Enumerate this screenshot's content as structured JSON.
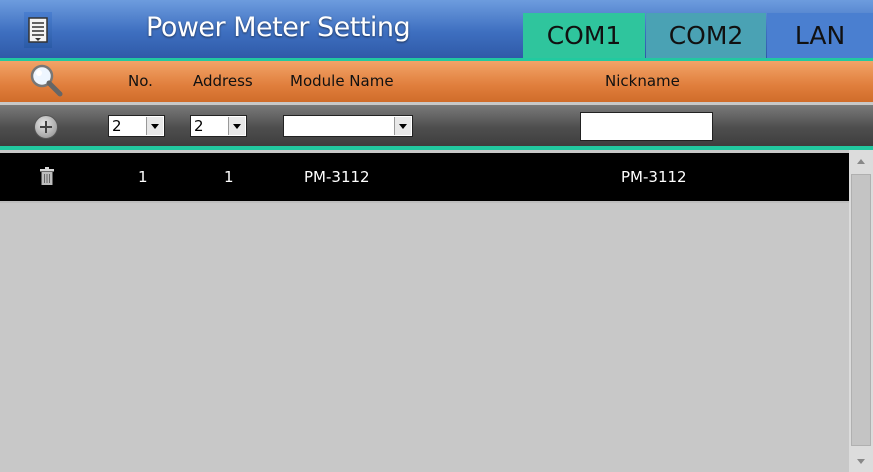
{
  "window": {
    "title": "Power Meter Setting",
    "tabs": [
      {
        "label": "COM1",
        "active": true,
        "color": "#2fc59d"
      },
      {
        "label": "COM2",
        "active": false,
        "color": "#4aa2b4"
      },
      {
        "label": "LAN",
        "active": false,
        "color": "#4a7fd0"
      }
    ]
  },
  "header": {
    "columns": {
      "no": "No.",
      "address": "Address",
      "module_name": "Module Name",
      "nickname": "Nickname"
    }
  },
  "input_row": {
    "no_value": "2",
    "address_value": "2",
    "module_value": "",
    "nickname_value": ""
  },
  "rows": [
    {
      "no": "1",
      "address": "1",
      "module_name": "PM-3112",
      "nickname": "PM-3112"
    }
  ],
  "icons": {
    "menu": "menu-list-icon",
    "search": "magnifier-icon",
    "add": "plus-circle-icon",
    "delete": "trash-icon"
  },
  "colors": {
    "title_bar": "#3e6fc0",
    "header_bar": "#e07e3c",
    "accent": "#22c9a0",
    "list_bg": "#c8c8c8",
    "row_bg": "#000000"
  }
}
